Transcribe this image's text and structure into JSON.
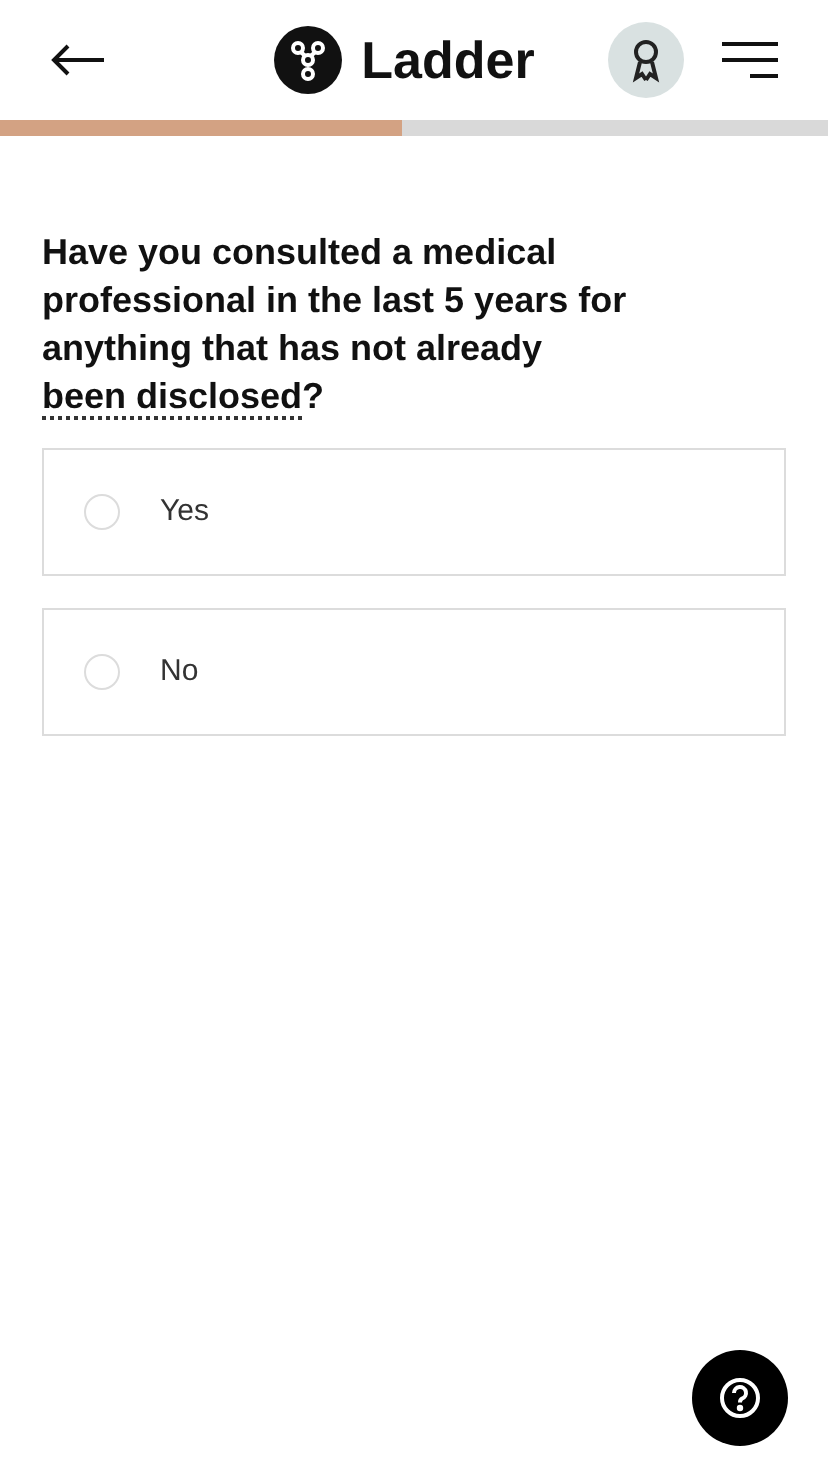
{
  "header": {
    "brand": "Ladder"
  },
  "progress": {
    "level": 0.485
  },
  "question": {
    "text": "Have you consulted a medical professional in the last 5 years for anything that has not already ",
    "term": "been disclosed",
    "end": "?"
  },
  "options": [
    {
      "label": "Yes",
      "selected": false
    },
    {
      "label": "No",
      "selected": false
    }
  ]
}
